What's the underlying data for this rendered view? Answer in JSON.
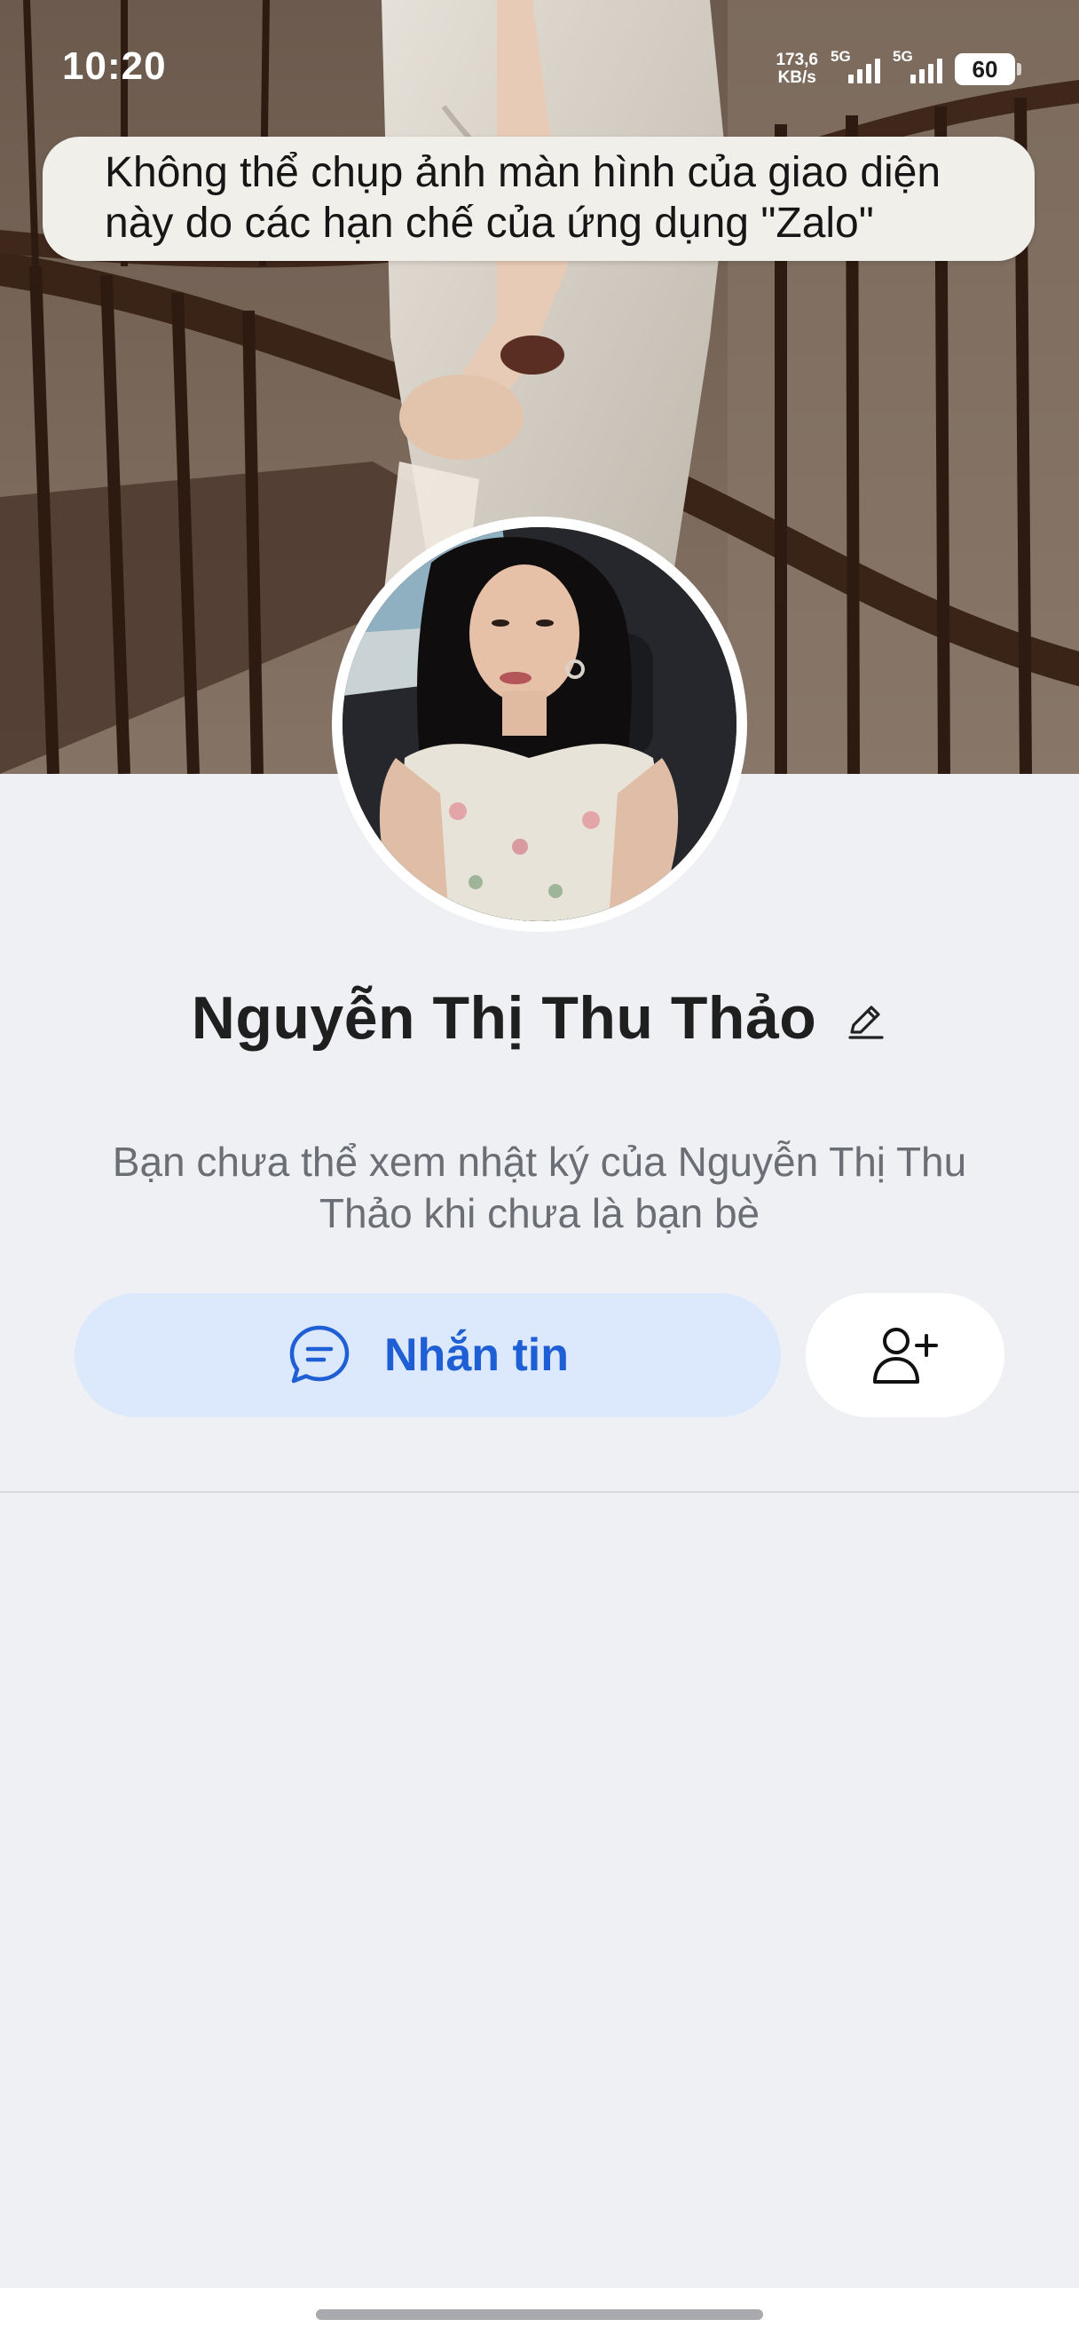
{
  "status_bar": {
    "time": "10:20",
    "net_speed_value": "173,6",
    "net_speed_unit": "KB/s",
    "sim1_tag": "5G",
    "sim2_tag": "5G",
    "battery": "60"
  },
  "toast": {
    "message": "Không thể chụp ảnh màn hình của giao diện này do các hạn chế của ứng dụng \"Zalo\""
  },
  "profile": {
    "name": "Nguyễn Thị Thu Thảo",
    "info": "Bạn chưa thể xem nhật ký của Nguyễn Thị Thu Thảo khi chưa là bạn bè"
  },
  "actions": {
    "message_label": "Nhắn tin"
  },
  "colors": {
    "accent": "#1f5fd6",
    "accent_bg": "#dce8fc",
    "page_bg": "#eff0f4"
  }
}
